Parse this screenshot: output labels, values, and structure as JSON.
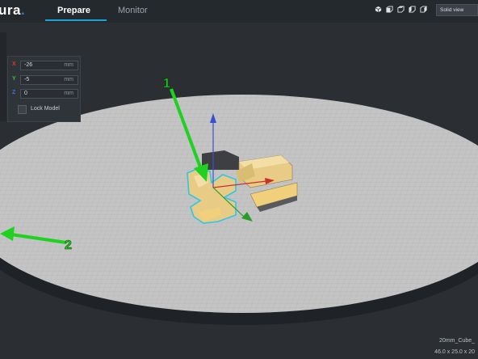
{
  "header": {
    "logo": "ura",
    "logo_dot": ".",
    "tabs": [
      {
        "label": "Prepare",
        "active": true
      },
      {
        "label": "Monitor",
        "active": false
      }
    ],
    "view_icons": [
      "3d-view-icon",
      "front-view-icon",
      "top-view-icon",
      "left-view-icon",
      "right-view-icon"
    ],
    "view_mode": "Solid view"
  },
  "move_panel": {
    "fields": [
      {
        "axis": "X",
        "value": "-26",
        "unit": "mm",
        "color": "#e5372b"
      },
      {
        "axis": "Y",
        "value": "-5",
        "unit": "mm",
        "color": "#3cbf34"
      },
      {
        "axis": "Z",
        "value": "0",
        "unit": "mm",
        "color": "#3b6fe0"
      }
    ],
    "lock_label": "Lock Model",
    "lock_checked": false
  },
  "annotations": [
    {
      "label": "1",
      "color": "#1fd21f"
    },
    {
      "label": "2",
      "color": "#1fd21f"
    }
  ],
  "object_info": {
    "name": "20mm_Cube_",
    "dimensions": "46.0 x 25.0 x 20"
  },
  "colors": {
    "accent": "#18a3d9",
    "model": "#e8cc86",
    "selection_outline": "#2fc6e8",
    "build_plate": "#c4c4c4"
  }
}
